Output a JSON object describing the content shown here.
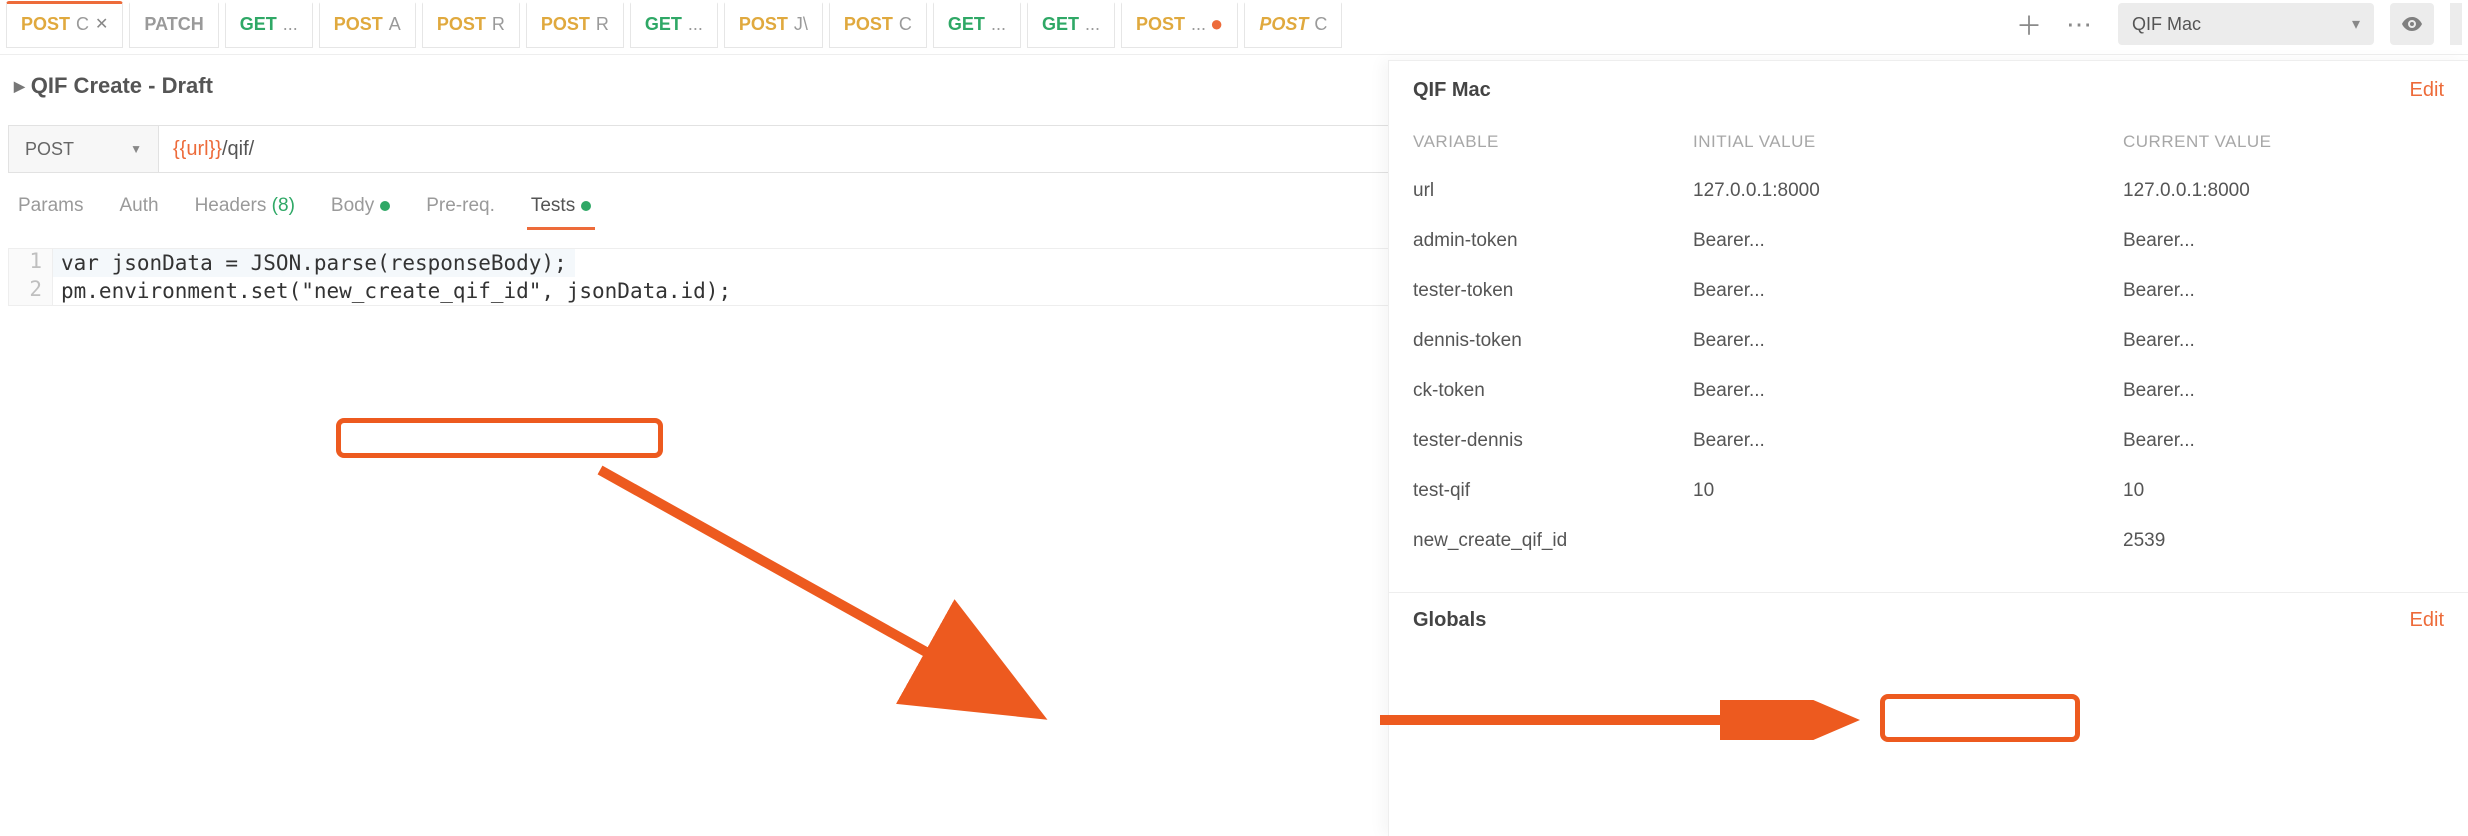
{
  "tabs": [
    {
      "method": "POST",
      "mclass": "post",
      "rest": "C",
      "close": true,
      "active": true
    },
    {
      "method": "PATCH",
      "mclass": "patch",
      "rest": ""
    },
    {
      "method": "GET",
      "mclass": "get",
      "rest": "..."
    },
    {
      "method": "POST",
      "mclass": "post",
      "rest": "A"
    },
    {
      "method": "POST",
      "mclass": "post",
      "rest": "R"
    },
    {
      "method": "POST",
      "mclass": "post",
      "rest": "R"
    },
    {
      "method": "GET",
      "mclass": "get",
      "rest": "..."
    },
    {
      "method": "POST",
      "mclass": "post",
      "rest": "J\\"
    },
    {
      "method": "POST",
      "mclass": "post",
      "rest": "C"
    },
    {
      "method": "GET",
      "mclass": "get",
      "rest": "..."
    },
    {
      "method": "GET",
      "mclass": "get",
      "rest": "..."
    },
    {
      "method": "POST",
      "mclass": "post",
      "rest": "...",
      "dot": true
    },
    {
      "method": "POST",
      "mclass": "post-italic",
      "rest": "C"
    }
  ],
  "env_selector": "QIF Mac",
  "breadcrumb": "QIF Create - Draft",
  "request": {
    "method": "POST",
    "url_var": "{{url}}",
    "url_path": "/qif/"
  },
  "sub_tabs": {
    "params": "Params",
    "auth": "Auth",
    "headers_label": "Headers",
    "headers_count": "(8)",
    "body": "Body",
    "prereq": "Pre-req.",
    "tests": "Tests"
  },
  "code": [
    "var jsonData = JSON.parse(responseBody);",
    "pm.environment.set(\"new_create_qif_id\", jsonData.id);"
  ],
  "env_panel": {
    "title": "QIF Mac",
    "edit_label": "Edit",
    "col_variable": "VARIABLE",
    "col_initial": "INITIAL VALUE",
    "col_current": "CURRENT VALUE",
    "rows": [
      {
        "variable": "url",
        "initial": "127.0.0.1:8000",
        "current": "127.0.0.1:8000"
      },
      {
        "variable": "admin-token",
        "initial": "Bearer...",
        "current": "Bearer..."
      },
      {
        "variable": "tester-token",
        "initial": "Bearer...",
        "current": "Bearer..."
      },
      {
        "variable": "dennis-token",
        "initial": "Bearer...",
        "current": "Bearer..."
      },
      {
        "variable": "ck-token",
        "initial": "Bearer...",
        "current": "Bearer..."
      },
      {
        "variable": "tester-dennis",
        "initial": "Bearer...",
        "current": "Bearer..."
      },
      {
        "variable": "test-qif",
        "initial": "10",
        "current": "10"
      },
      {
        "variable": "new_create_qif_id",
        "initial": "",
        "current": "2539"
      }
    ],
    "globals_label": "Globals"
  }
}
